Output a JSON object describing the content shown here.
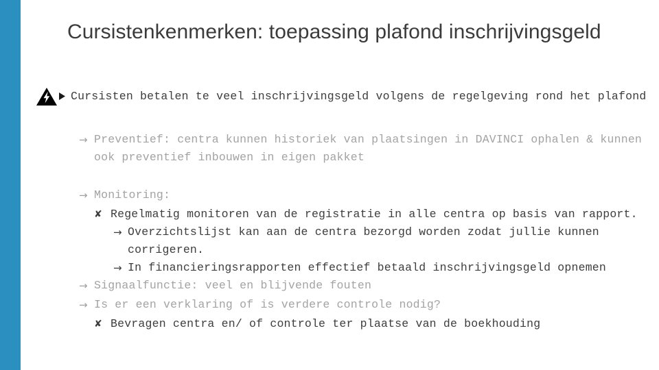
{
  "slide": {
    "accent_color": "#2b8fbf",
    "background_color": "#ffffff",
    "title": "Cursistenkenmerken: toepassing plafond inschrijvingsgeld"
  },
  "icons": {
    "warning": "warning-lightning-triangle-icon",
    "bullet_triangle": "triangle-right-bullet-icon",
    "arrow": "→",
    "cross": "✘"
  },
  "content": {
    "level1": {
      "text": "Cursisten betalen te veel inschrijvingsgeld volgens de regelgeving rond het plafond"
    },
    "preventief": {
      "marker": "→",
      "text": "Preventief: centra kunnen historiek van plaatsingen in DAVINCI ophalen & kunnen ook preventief inbouwen in eigen pakket"
    },
    "monitoring": {
      "marker": "→",
      "text": "Monitoring:",
      "items": [
        {
          "marker": "✘",
          "text": "Regelmatig monitoren van de registratie in alle centra op basis van rapport.",
          "subitems": [
            {
              "marker": "→",
              "text": "Overzichtslijst kan aan de centra bezorgd worden zodat jullie kunnen corrigeren."
            },
            {
              "marker": "→",
              "text": "In financieringsrapporten effectief betaald inschrijvingsgeld opnemen"
            }
          ]
        }
      ]
    },
    "signaalfunctie": {
      "marker": "→",
      "text": "Signaalfunctie: veel en blijvende fouten"
    },
    "verklaring": {
      "marker": "→",
      "text": "Is er een verklaring of is verdere controle nodig?"
    },
    "bevragen": {
      "marker": "✘",
      "text": "Bevragen centra en/ of controle ter plaatse van de boekhouding"
    }
  }
}
